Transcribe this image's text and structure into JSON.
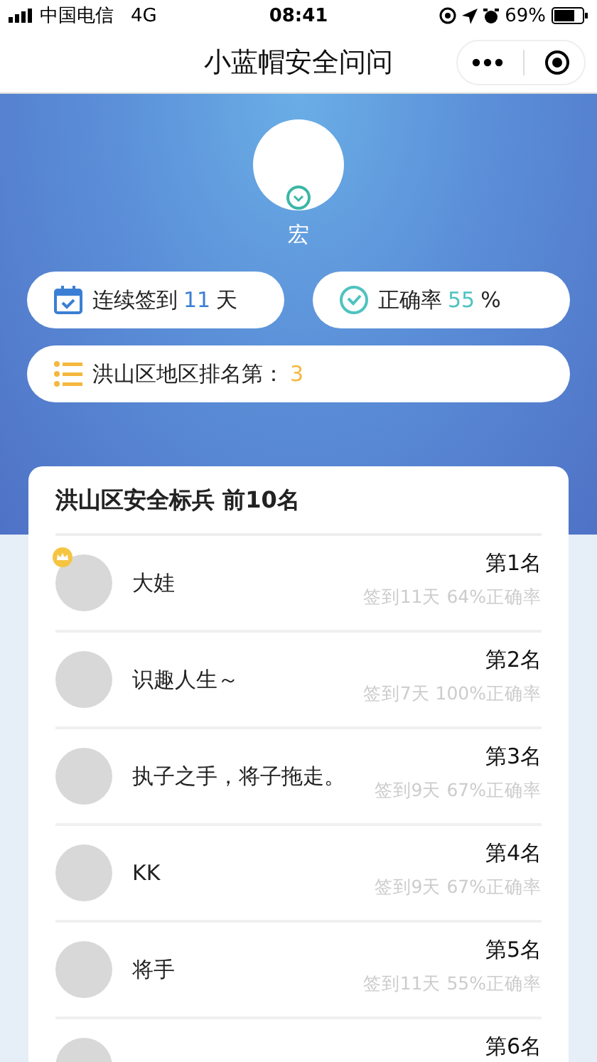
{
  "status_bar": {
    "carrier": "中国电信",
    "network": "4G",
    "time": "08:41",
    "battery": "69%"
  },
  "nav": {
    "title": "小蓝帽安全问问"
  },
  "profile": {
    "name": "宏"
  },
  "stats": [
    {
      "kind": "calendar",
      "label": "连续签到",
      "value": "11",
      "unit": "天",
      "color": "#3b7fd4"
    },
    {
      "kind": "check",
      "label": "正确率",
      "value": "55",
      "unit": "%",
      "color": "#4fc3c0"
    },
    {
      "kind": "list",
      "label": "洪山区地区排名第：",
      "value": "3",
      "color": "#f5b83d"
    }
  ],
  "leaderboard": {
    "title": "洪山区安全标兵 前10名",
    "rows": [
      {
        "name": "大娃",
        "rank": "第1名",
        "detail": "签到11天 64%正确率",
        "crown": true
      },
      {
        "name": "识趣人生～",
        "rank": "第2名",
        "detail": "签到7天 100%正确率",
        "crown": false
      },
      {
        "name": "执子之手，将子拖走。",
        "rank": "第3名",
        "detail": "签到9天 67%正确率",
        "crown": false
      },
      {
        "name": "KK",
        "rank": "第4名",
        "detail": "签到9天 67%正确率",
        "crown": false
      },
      {
        "name": "将手",
        "rank": "第5名",
        "detail": "签到11天 55%正确率",
        "crown": false
      },
      {
        "rank": "第6名",
        "crown": false
      }
    ]
  }
}
